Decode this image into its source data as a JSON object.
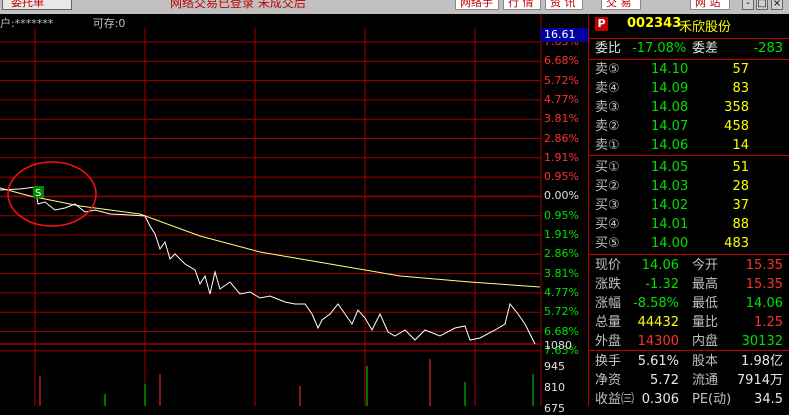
{
  "topbar": {
    "status": "网络交易已登录 未成交后",
    "tab_left": "委托单",
    "menu": [
      "网络手",
      "行 情",
      "资 讯",
      "交 易",
      "网 站"
    ],
    "window_controls": [
      "-",
      "□",
      "×"
    ]
  },
  "account": {
    "label": "户:*******",
    "prefix": "可",
    "stock_text": "存:0"
  },
  "chart": {
    "current_price_label": "16.61",
    "percent_ticks": [
      "7.63%",
      "6.68%",
      "5.72%",
      "4.77%",
      "3.81%",
      "2.86%",
      "1.91%",
      "0.95%",
      "0.00%",
      "0.95%",
      "1.91%",
      "2.86%",
      "3.81%",
      "4.77%",
      "5.72%",
      "6.68%",
      "7.63%"
    ],
    "volume_ticks": [
      "1080",
      "945",
      "810",
      "675"
    ],
    "marker_label": "S",
    "colors": {
      "up": "#ff3030",
      "down": "#00e000",
      "grid": "#a00000",
      "price_line": "#ffffff",
      "avg_line": "#ffff80"
    }
  },
  "quote_panel": {
    "badge": "P",
    "code": "002343",
    "name": "禾欣股份",
    "weibi_label": "委比",
    "weibi_value": "-17.08%",
    "weicha_label": "委差",
    "weicha_value": "-283",
    "asks": [
      {
        "label": "卖⑤",
        "price": "14.10",
        "vol": "57"
      },
      {
        "label": "卖④",
        "price": "14.09",
        "vol": "83"
      },
      {
        "label": "卖③",
        "price": "14.08",
        "vol": "358"
      },
      {
        "label": "卖②",
        "price": "14.07",
        "vol": "458"
      },
      {
        "label": "卖①",
        "price": "14.06",
        "vol": "14"
      }
    ],
    "bids": [
      {
        "label": "买①",
        "price": "14.05",
        "vol": "51"
      },
      {
        "label": "买②",
        "price": "14.03",
        "vol": "28"
      },
      {
        "label": "买③",
        "price": "14.02",
        "vol": "37"
      },
      {
        "label": "买④",
        "price": "14.01",
        "vol": "88"
      },
      {
        "label": "买⑤",
        "price": "14.00",
        "vol": "483"
      }
    ],
    "stats": [
      {
        "l1": "现价",
        "v1": "14.06",
        "c1": "green",
        "l2": "今开",
        "v2": "15.35",
        "c2": "red"
      },
      {
        "l1": "涨跌",
        "v1": "-1.32",
        "c1": "green",
        "l2": "最高",
        "v2": "15.35",
        "c2": "red"
      },
      {
        "l1": "涨幅",
        "v1": "-8.58%",
        "c1": "green",
        "l2": "最低",
        "v2": "14.06",
        "c2": "green"
      },
      {
        "l1": "总量",
        "v1": "44432",
        "c1": "yellow",
        "l2": "量比",
        "v2": "1.25",
        "c2": "red"
      },
      {
        "l1": "外盘",
        "v1": "14300",
        "c1": "red",
        "l2": "内盘",
        "v2": "30132",
        "c2": "green"
      }
    ],
    "stats2": [
      {
        "l1": "换手",
        "v1": "5.61%",
        "c1": "white",
        "l2": "股本",
        "v2": "1.98亿",
        "c2": "white"
      },
      {
        "l1": "净资",
        "v1": "5.72",
        "c1": "white",
        "l2": "流通",
        "v2": "7914万",
        "c2": "white"
      },
      {
        "l1": "收益㈢",
        "v1": "0.306",
        "c1": "white",
        "l2": "PE(动)",
        "v2": "34.5",
        "c2": "white"
      }
    ]
  }
}
